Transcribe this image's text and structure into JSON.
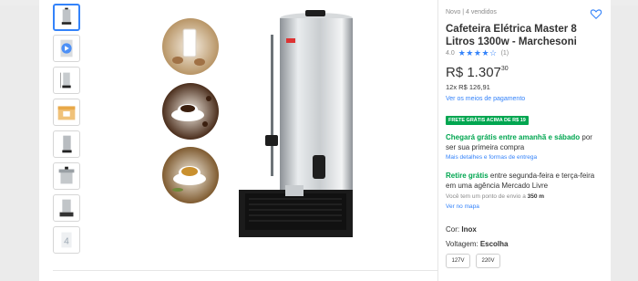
{
  "thumbnails": [
    {
      "label": "",
      "icon": "urn-icon"
    },
    {
      "label": "",
      "icon": "video-icon"
    },
    {
      "label": "",
      "icon": "urn-dimensions-icon"
    },
    {
      "label": "",
      "icon": "package-icon"
    },
    {
      "label": "",
      "icon": "urn-side-icon"
    },
    {
      "label": "",
      "icon": "lid-icon"
    },
    {
      "label": "",
      "icon": "urn-box-icon"
    },
    {
      "label": "4",
      "icon": "more-images-icon"
    }
  ],
  "product": {
    "condition": "Novo  |  4 vendidos",
    "title": "Cafeteira Elétrica Master 8 Litros 1300w - Marchesoni",
    "rating_value": "4.0",
    "rating_count": "(1)",
    "stars": "★★★★☆",
    "price_main": "R$ 1.307",
    "price_cents": "30",
    "installments": "12x R$ 126,91",
    "payment_link": "Ver os meios de pagamento",
    "shipping_badge": "FRETE GRÁTIS ACIMA DE R$ 19",
    "delivery_highlight": "Chegará grátis entre amanhã e sábado",
    "delivery_rest": " por ser sua primeira compra",
    "delivery_details_link": "Mais detalhes e formas de entrega",
    "pickup_highlight": "Retire grátis",
    "pickup_rest": " entre segunda-feira e terça-feira em uma agência Mercado Livre",
    "pickup_note_prefix": "Você tem um ponto de envio a ",
    "pickup_distance": "350 m",
    "map_link": "Ver no mapa",
    "color_label": "Cor: ",
    "color_value": "Inox",
    "voltage_label": "Voltagem: ",
    "voltage_value": "Escolha",
    "voltage_options": [
      "127V",
      "220V"
    ]
  },
  "colors": {
    "accent": "#3483fa",
    "green": "#00a650"
  }
}
